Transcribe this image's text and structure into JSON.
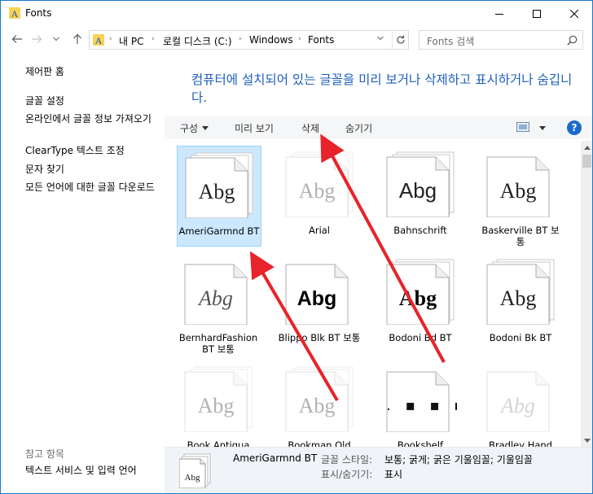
{
  "window": {
    "title": "Fonts"
  },
  "nav": {
    "breadcrumbs": [
      "내 PC",
      "로컬 디스크 (C:)",
      "Windows",
      "Fonts"
    ],
    "search_placeholder": "Fonts 검색"
  },
  "sidebar": {
    "home": "제어판 홈",
    "links": [
      "글꼴 설정",
      "온라인에서 글꼴 정보 가져오기",
      "ClearType 텍스트 조정",
      "문자 찾기",
      "모든 언어에 대한 글꼴 다운로드"
    ],
    "see_also_heading": "참고 항목",
    "see_also": [
      "텍스트 서비스 및 입력 언어"
    ]
  },
  "main": {
    "description": "컴퓨터에 설치되어 있는 글꼴을 미리 보거나 삭제하고 표시하거나 숨깁니다.",
    "toolbar": {
      "organize": "구성",
      "preview": "미리 보기",
      "delete": "삭제",
      "hide": "숨기기"
    },
    "fonts": [
      {
        "name": "AmeriGarmnd BT",
        "sample": "Abg",
        "selected": true,
        "faded": false,
        "stacked": true
      },
      {
        "name": "Arial",
        "sample": "Abg",
        "selected": false,
        "faded": true,
        "stacked": true
      },
      {
        "name": "Bahnschrift",
        "sample": "Abg",
        "selected": false,
        "faded": false,
        "stacked": true
      },
      {
        "name": "Baskerville BT 보통",
        "sample": "Abg",
        "selected": false,
        "faded": false,
        "stacked": false
      },
      {
        "name": "BernhardFashion BT 보통",
        "sample": "Abg",
        "selected": false,
        "faded": false,
        "stacked": false
      },
      {
        "name": "Blippo Blk BT 보통",
        "sample": "Abg",
        "selected": false,
        "faded": false,
        "stacked": false
      },
      {
        "name": "Bodoni Bd BT",
        "sample": "Abg",
        "selected": false,
        "faded": false,
        "stacked": true
      },
      {
        "name": "Bodoni Bk BT",
        "sample": "Abg",
        "selected": false,
        "faded": false,
        "stacked": true
      },
      {
        "name": "Book Antiqua",
        "sample": "Abg",
        "selected": false,
        "faded": true,
        "stacked": true
      },
      {
        "name": "Bookman Old",
        "sample": "Abg",
        "selected": false,
        "faded": true,
        "stacked": true
      },
      {
        "name": "Bookshelf",
        "sample": ".:. ▪ ▪ ▪",
        "selected": false,
        "faded": false,
        "stacked": false
      },
      {
        "name": "Bradley Hand",
        "sample": "Abg",
        "selected": false,
        "faded": true,
        "stacked": false
      }
    ]
  },
  "details": {
    "name": "AmeriGarmnd BT",
    "thumb_sample": "Abg",
    "style_label": "글꼴 스타일:",
    "style_value": "보통; 굵게; 굵은 기울임꼴; 기울임꼴",
    "visibility_label": "표시/숨기기:",
    "visibility_value": "표시"
  },
  "colors": {
    "accent": "#1e5ebd",
    "selection": "#cce8ff",
    "annotation": "#e8232a"
  }
}
